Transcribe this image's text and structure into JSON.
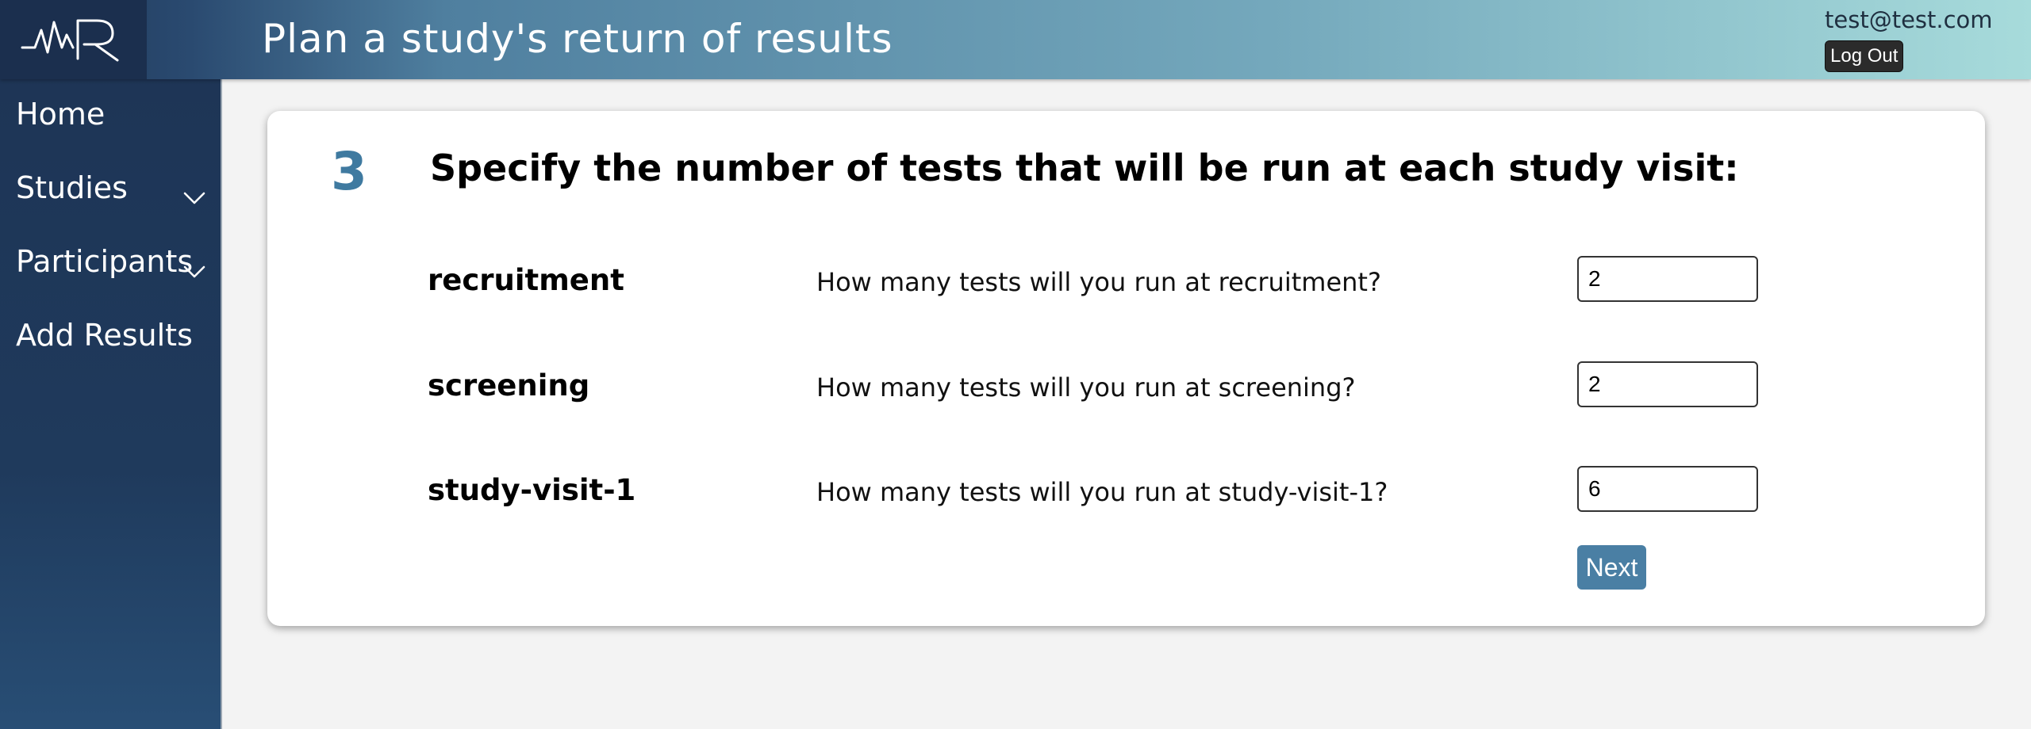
{
  "header": {
    "title": "Plan a study's return of results",
    "user_email": "test@test.com",
    "logout_label": "Log Out",
    "logo_icon": "heartbeat-r-logo"
  },
  "sidebar": {
    "items": [
      {
        "label": "Home",
        "has_submenu": false
      },
      {
        "label": "Studies",
        "has_submenu": true,
        "icon": "chevron-down-icon"
      },
      {
        "label": "Participants",
        "has_submenu": true,
        "icon": "chevron-down-icon"
      },
      {
        "label": "Add Results",
        "has_submenu": false
      }
    ]
  },
  "step": {
    "number": "3",
    "title": "Specify the number of tests that will be run at each study visit:",
    "rows": [
      {
        "visit": "recruitment",
        "question": "How many tests will you run at recruitment?",
        "value": "2"
      },
      {
        "visit": "screening",
        "question": "How many tests will you run at screening?",
        "value": "2"
      },
      {
        "visit": "study-visit-1",
        "question": "How many tests will you run at study-visit-1?",
        "value": "6"
      }
    ],
    "next_label": "Next"
  },
  "colors": {
    "sidebar_bg": "#1e3556",
    "accent": "#4a7fa4",
    "step_number": "#3f7aa0",
    "header_gradient_end": "#a7dbdb"
  }
}
